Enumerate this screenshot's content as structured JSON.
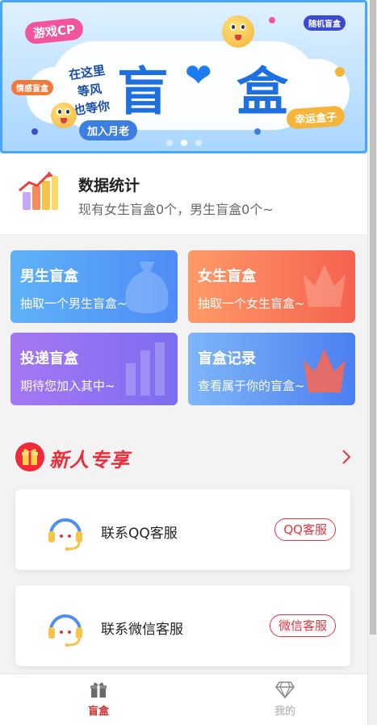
{
  "banner": {
    "tag_game_cp": "游戏CP",
    "tag_random": "随机盲盒",
    "tag_emotion": "情感盲盒",
    "title_left": "盲",
    "title_right": "盒",
    "handwriting_1": "在这里",
    "handwriting_2": "等风",
    "handwriting_3": "也等你",
    "tag_join": "加入月老",
    "tag_lucky": "幸运盒子",
    "slides": 3,
    "active_slide": 2
  },
  "stats": {
    "title": "数据统计",
    "subtitle": "现有女生盲盒0个，男生盲盒0个~"
  },
  "cards": {
    "boy": {
      "title": "男生盲盒",
      "subtitle": "抽取一个男生盲盒~"
    },
    "girl": {
      "title": "女生盲盒",
      "subtitle": "抽取一个女生盲盒~"
    },
    "deliver": {
      "title": "投递盲盒",
      "subtitle": "期待您加入其中~"
    },
    "record": {
      "title": "盲盒记录",
      "subtitle": "查看属于你的盲盒~"
    }
  },
  "new_user": {
    "title": "新人专享"
  },
  "services": {
    "qq": {
      "label": "联系QQ客服",
      "button": "QQ客服"
    },
    "wechat": {
      "label": "联系微信客服",
      "button": "微信客服"
    }
  },
  "tabbar": {
    "home": "盲盒",
    "mine": "我的"
  },
  "colors": {
    "accent_red": "#d62a2a",
    "banner_border": "#49a6f6",
    "title_blue": "#1e6fe0"
  }
}
